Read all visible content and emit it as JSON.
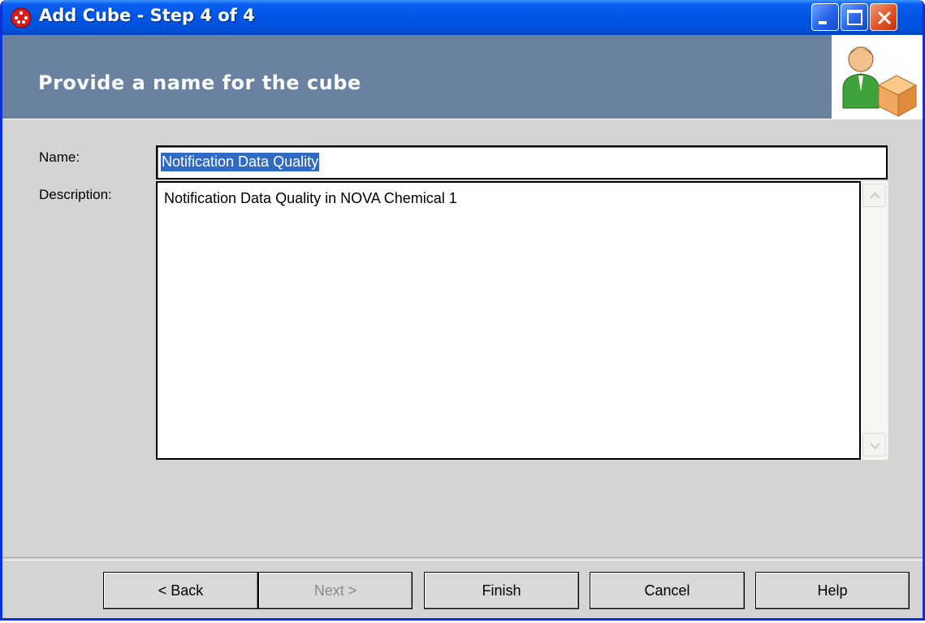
{
  "window": {
    "title": "Add Cube - Step 4 of 4"
  },
  "header": {
    "title": "Provide a name for the cube"
  },
  "form": {
    "name_label": "Name:",
    "name_value": "Notification Data Quality",
    "description_label": "Description:",
    "description_value": "Notification Data Quality in NOVA Chemical 1"
  },
  "buttons": {
    "back": "< Back",
    "next": "Next >",
    "finish": "Finish",
    "cancel": "Cancel",
    "help": "Help"
  },
  "colors": {
    "titlebar": "#0055e5",
    "header_band": "#6a829f",
    "selection": "#316ac5",
    "dialog_bg": "#d4d4d4"
  },
  "icons": {
    "app": "app-icon",
    "header": "user-cube-icon",
    "minimize": "minimize-icon",
    "maximize": "maximize-icon",
    "close": "close-icon"
  }
}
